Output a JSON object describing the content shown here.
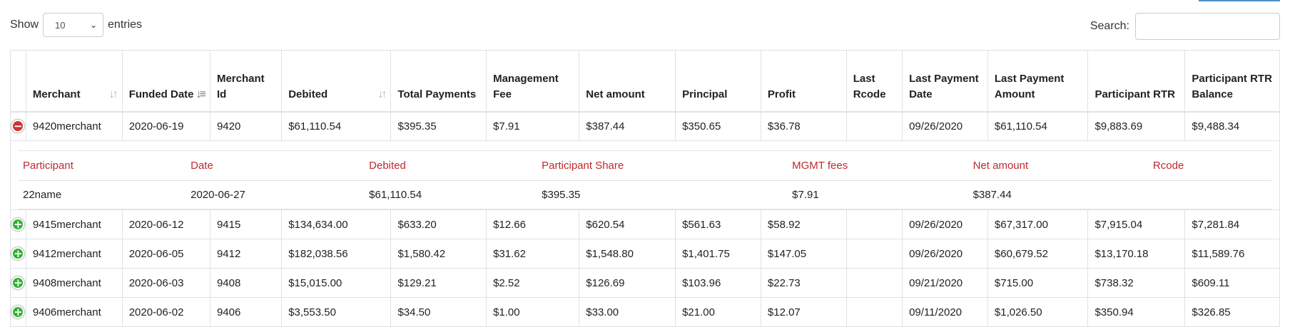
{
  "controls": {
    "show_label": "Show",
    "entries_label": "entries",
    "page_length": "10",
    "search_label": "Search:",
    "search_value": ""
  },
  "columns": [
    {
      "label": "Merchant",
      "sort": "both"
    },
    {
      "label": "Funded Date",
      "sort": "desc"
    },
    {
      "label": "Merchant Id",
      "sort": "none"
    },
    {
      "label": "Debited",
      "sort": "both"
    },
    {
      "label": "Total Payments",
      "sort": "none"
    },
    {
      "label": "Management Fee",
      "sort": "none"
    },
    {
      "label": "Net amount",
      "sort": "none"
    },
    {
      "label": "Principal",
      "sort": "none"
    },
    {
      "label": "Profit",
      "sort": "none"
    },
    {
      "label": "Last Rcode",
      "sort": "none"
    },
    {
      "label": "Last Payment Date",
      "sort": "none"
    },
    {
      "label": "Last Payment Amount",
      "sort": "none"
    },
    {
      "label": "Participant RTR",
      "sort": "none"
    },
    {
      "label": "Participant RTR Balance",
      "sort": "none"
    }
  ],
  "rows": [
    {
      "expanded": true,
      "cells": [
        "9420merchant",
        "2020-06-19",
        "9420",
        "$61,110.54",
        "$395.35",
        "$7.91",
        "$387.44",
        "$350.65",
        "$36.78",
        "",
        "09/26/2020",
        "$61,110.54",
        "$9,883.69",
        "$9,488.34"
      ]
    },
    {
      "expanded": false,
      "cells": [
        "9415merchant",
        "2020-06-12",
        "9415",
        "$134,634.00",
        "$633.20",
        "$12.66",
        "$620.54",
        "$561.63",
        "$58.92",
        "",
        "09/26/2020",
        "$67,317.00",
        "$7,915.04",
        "$7,281.84"
      ]
    },
    {
      "expanded": false,
      "cells": [
        "9412merchant",
        "2020-06-05",
        "9412",
        "$182,038.56",
        "$1,580.42",
        "$31.62",
        "$1,548.80",
        "$1,401.75",
        "$147.05",
        "",
        "09/26/2020",
        "$60,679.52",
        "$13,170.18",
        "$11,589.76"
      ]
    },
    {
      "expanded": false,
      "cells": [
        "9408merchant",
        "2020-06-03",
        "9408",
        "$15,015.00",
        "$129.21",
        "$2.52",
        "$126.69",
        "$103.96",
        "$22.73",
        "",
        "09/21/2020",
        "$715.00",
        "$738.32",
        "$609.11"
      ]
    },
    {
      "expanded": false,
      "cells": [
        "9406merchant",
        "2020-06-02",
        "9406",
        "$3,553.50",
        "$34.50",
        "$1.00",
        "$33.00",
        "$21.00",
        "$12.07",
        "",
        "09/11/2020",
        "$1,026.50",
        "$350.94",
        "$326.85"
      ]
    }
  ],
  "detail": {
    "headers": [
      "Participant",
      "Date",
      "Debited",
      "Participant Share",
      "MGMT fees",
      "Net amount",
      "Rcode"
    ],
    "rows": [
      [
        "22name",
        "2020-06-27",
        "$61,110.54",
        "$395.35",
        "$7.91",
        "$387.44",
        ""
      ]
    ]
  },
  "colors": {
    "detail_header": "#c0292d",
    "expand_plus": "#31b131",
    "collapse_minus": "#d33333",
    "top_button_accent": "#4a90c8"
  },
  "icons": {
    "sort_both": "sort-both-icon",
    "sort_desc": "sort-desc-icon",
    "row_expand": "plus-circle-icon",
    "row_collapse": "minus-circle-icon",
    "select_arrow": "chevron-down-icon"
  }
}
